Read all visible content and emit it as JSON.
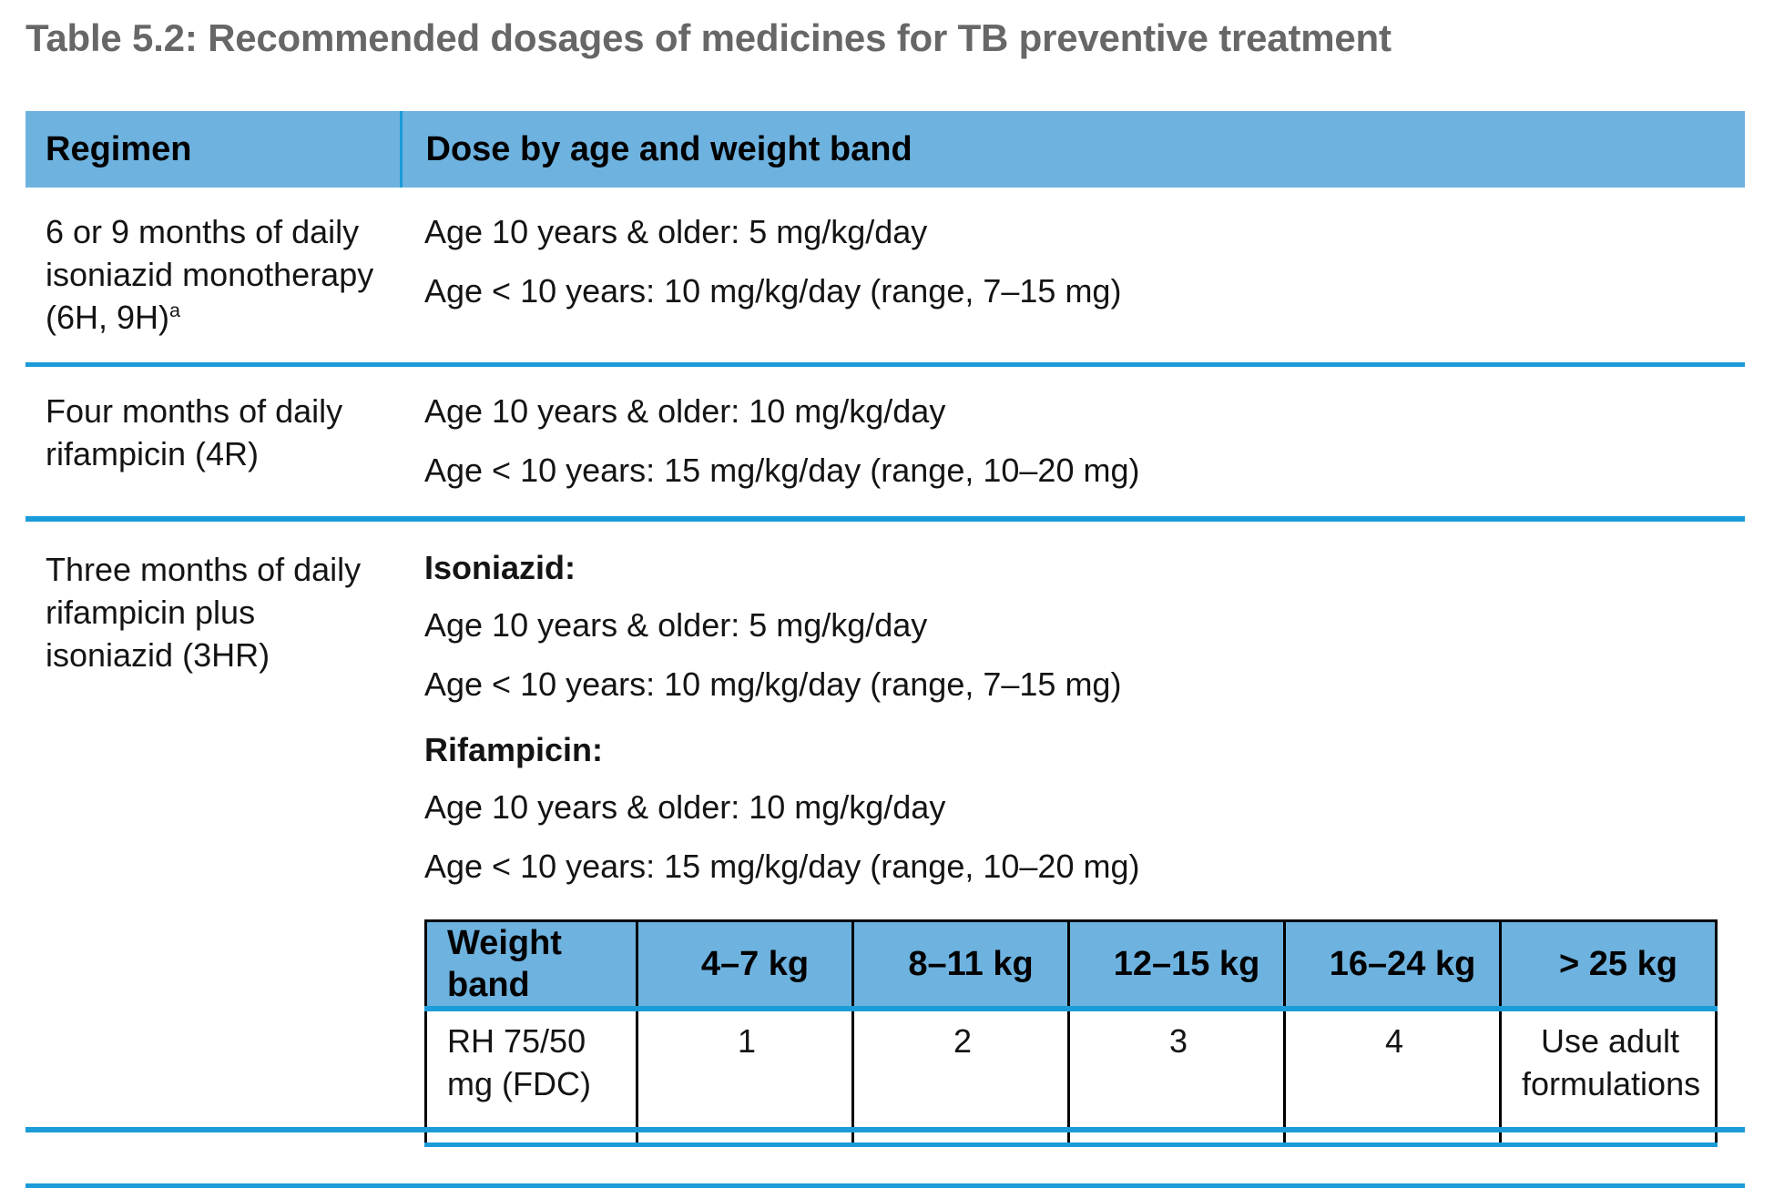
{
  "caption": "Table 5.2: Recommended dosages of medicines for TB preventive treatment",
  "colors": {
    "header_fill": "#6EB3E0",
    "rule": "#1B9BD8",
    "caption_text": "#676767",
    "body_text": "#141414",
    "nested_border": "#000000"
  },
  "header": {
    "regimen": "Regimen",
    "dose": "Dose by age and weight band"
  },
  "rows": [
    {
      "regimen": "6 or 9 months of daily isoniazid monotherapy (6H, 9H)",
      "regimen_superscript": "a",
      "dose_lines": [
        "Age 10 years & older: 5 mg/kg/day",
        "Age < 10 years: 10 mg/kg/day (range, 7–15 mg)"
      ]
    },
    {
      "regimen": "Four months of daily rifampicin (4R)",
      "regimen_superscript": "",
      "dose_lines": [
        "Age 10 years & older: 10 mg/kg/day",
        "Age < 10 years: 15 mg/kg/day (range, 10–20 mg)"
      ]
    },
    {
      "regimen": "Three months of daily rifampicin plus isoniazid (3HR)",
      "regimen_superscript": "",
      "isoniazid_heading": "Isoniazid:",
      "isoniazid_lines": [
        "Age 10 years & older: 5 mg/kg/day",
        "Age < 10 years: 10 mg/kg/day (range, 7–15 mg)"
      ],
      "rifampicin_heading": "Rifampicin:",
      "rifampicin_lines": [
        "Age 10 years & older: 10 mg/kg/day",
        "Age < 10 years: 15 mg/kg/day (range, 10–20 mg)"
      ]
    }
  ],
  "weight_table": {
    "header": [
      "Weight band",
      "4–7 kg",
      "8–11 kg",
      "12–15 kg",
      "16–24 kg",
      "> 25 kg"
    ],
    "row": [
      "RH 75/50 mg (FDC)",
      "1",
      "2",
      "3",
      "4",
      "Use adult formulations"
    ]
  }
}
